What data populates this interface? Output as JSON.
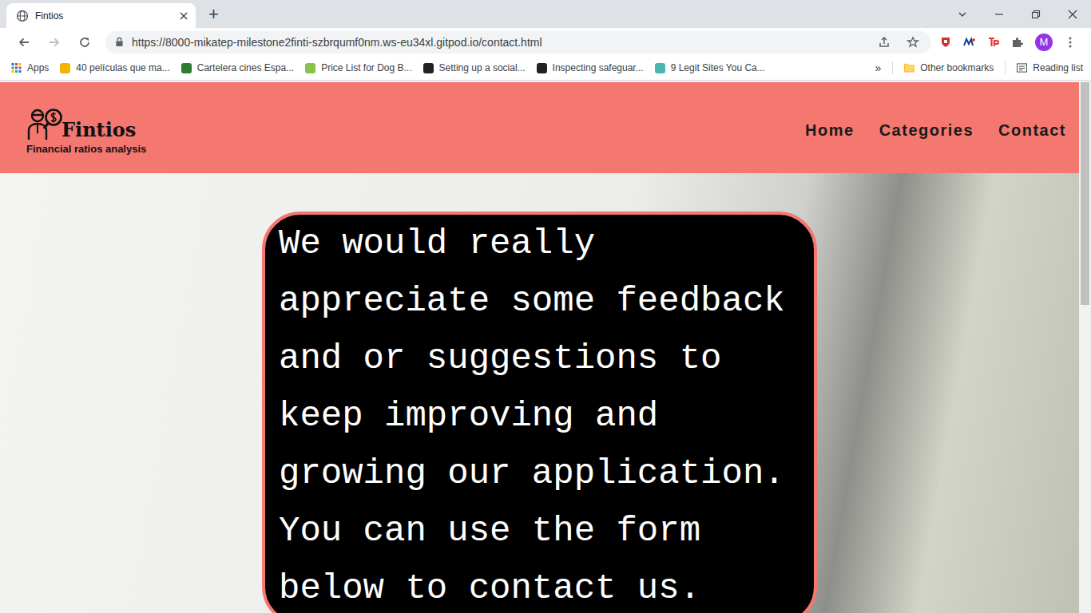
{
  "browser": {
    "tabs": [
      {
        "label": "Fintios",
        "selected": true
      }
    ],
    "new_tab": "+",
    "url": "https://8000-mikatep-milestone2finti-szbrqumf0nm.ws-eu34xl.gitpod.io/contact.html",
    "profile": "M",
    "bookmarks": [
      "Apps",
      "40 películas que ma...",
      "Cartelera cines Espa...",
      "Price List for Dog B...",
      "Setting up a social...",
      "Inspecting safeguar...",
      "9 Legit Sites You Ca..."
    ],
    "bookmarks_more": "»",
    "other_bookmarks": "Other bookmarks",
    "reading_list": "Reading list"
  },
  "site": {
    "logo": {
      "name": "Fintios",
      "tagline": "Financial ratios analysis"
    },
    "nav": [
      "Home",
      "Categories",
      "Contact"
    ],
    "message": "We would really appreciate some feedback and or suggestions to keep improving and growing our application. You can use the form below to contact us.",
    "scrollbar": {
      "level": 0.42
    }
  }
}
